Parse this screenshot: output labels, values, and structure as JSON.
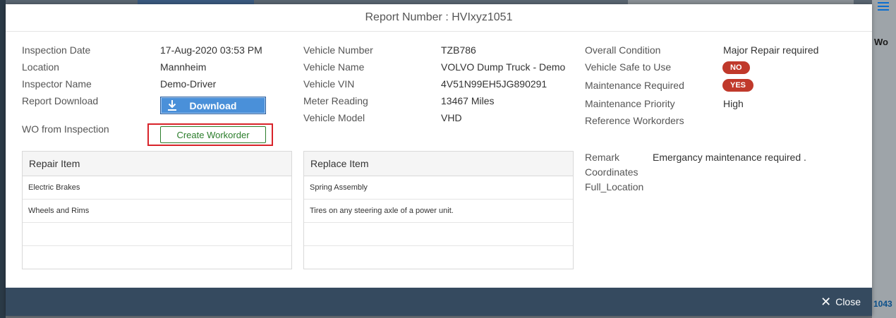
{
  "dialog": {
    "title": "Report Number : HVIxyz1051",
    "close_label": "Close"
  },
  "col1": {
    "inspection_date_label": "Inspection Date",
    "inspection_date_value": "17-Aug-2020 03:53 PM",
    "location_label": "Location",
    "location_value": "Mannheim",
    "inspector_label": "Inspector Name",
    "inspector_value": "Demo-Driver",
    "report_download_label": "Report Download",
    "download_button": "Download",
    "wo_label": "WO from Inspection",
    "create_workorder_button": "Create Workorder"
  },
  "col2": {
    "vehicle_number_label": "Vehicle Number",
    "vehicle_number_value": "TZB786",
    "vehicle_name_label": "Vehicle Name",
    "vehicle_name_value": "VOLVO Dump Truck - Demo",
    "vin_label": "Vehicle VIN",
    "vin_value": "4V51N99EH5JG890291",
    "meter_label": "Meter Reading",
    "meter_value": "13467 Miles",
    "model_label": "Vehicle Model",
    "model_value": "VHD"
  },
  "col3": {
    "condition_label": "Overall Condition",
    "condition_value": "Major Repair required",
    "safe_label": "Vehicle Safe to Use",
    "safe_value": "NO",
    "maint_req_label": "Maintenance Required",
    "maint_req_value": "YES",
    "priority_label": "Maintenance Priority",
    "priority_value": "High",
    "ref_wo_label": "Reference Workorders",
    "remark_label": "Remark",
    "remark_value": "Emergancy maintenance required .",
    "coordinates_label": "Coordinates",
    "full_location_label": "Full_Location"
  },
  "repair_table": {
    "header": "Repair Item",
    "rows": [
      "Electric Brakes",
      "Wheels and Rims",
      "",
      ""
    ]
  },
  "replace_table": {
    "header": "Replace Item",
    "rows": [
      "Spring Assembly",
      "Tires on any steering axle of a power unit.",
      "",
      ""
    ]
  },
  "background": {
    "right_header_fragment": "Wo",
    "right_number_fragment": "1043"
  },
  "colors": {
    "badge_red": "#c0392b",
    "footer": "#354a5f",
    "download_blue": "#4a90d9",
    "create_green": "#2b7d2b",
    "highlight_red": "#d8232a"
  }
}
